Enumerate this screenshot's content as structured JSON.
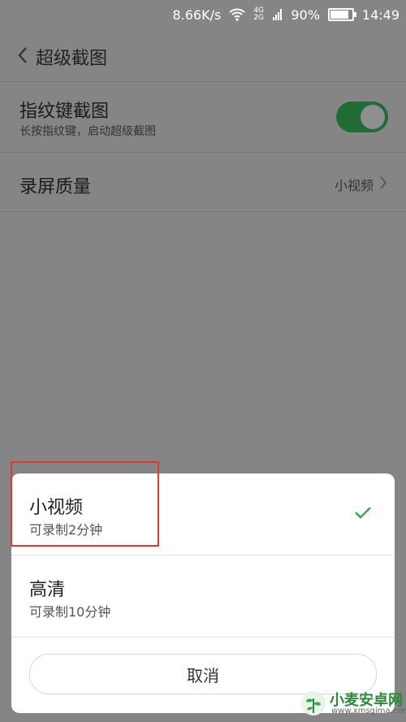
{
  "status_bar": {
    "speed": "8.66K/s",
    "network": "4G 2G",
    "battery_text": "90%",
    "battery_level": 0.9,
    "time": "14:49"
  },
  "header": {
    "title": "超级截图",
    "back_icon": "back-chevron-icon"
  },
  "settings": {
    "fingerprint": {
      "title": "指纹键截图",
      "subtitle": "长按指纹键，启动超级截图",
      "toggle_on": true
    },
    "quality": {
      "title": "录屏质量",
      "value": "小视频"
    }
  },
  "dialog": {
    "options": [
      {
        "title": "小视频",
        "subtitle": "可录制2分钟",
        "selected": true
      },
      {
        "title": "高清",
        "subtitle": "可录制10分钟",
        "selected": false
      }
    ],
    "cancel_label": "取消"
  },
  "colors": {
    "toggle_on": "#1f6d35",
    "check": "#2ea84a",
    "highlight_box": "#e0392b"
  },
  "watermark": {
    "name": "小麦安卓网",
    "url": "www.xmsgima.com"
  }
}
